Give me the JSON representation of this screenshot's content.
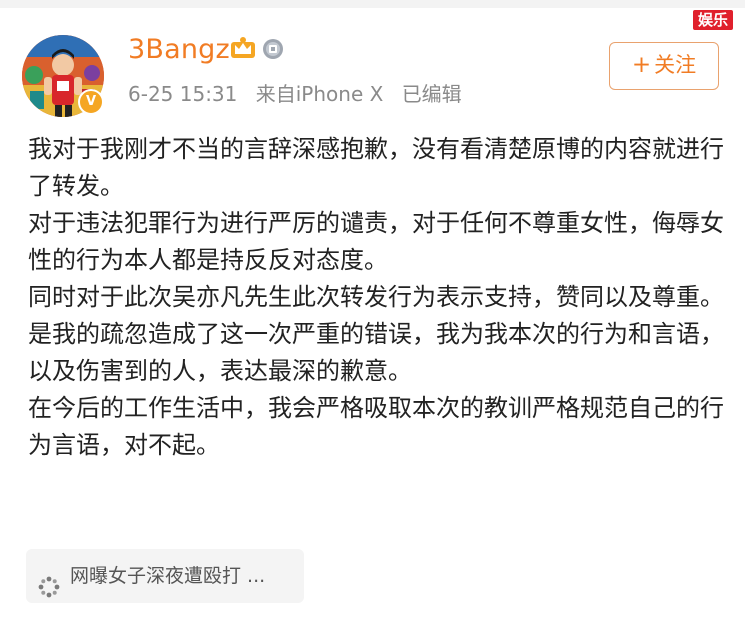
{
  "watermark": {
    "label": "娱乐"
  },
  "user": {
    "name": "3Bangz",
    "crown_icon": "crown-icon",
    "medal_icon": "medal-icon",
    "verified_icon": "verified-badge-icon"
  },
  "meta": {
    "time": "6-25 15:31",
    "source": "来自iPhone X",
    "edited": "已编辑"
  },
  "follow_button": {
    "plus": "+",
    "label": "关注"
  },
  "post": {
    "paragraphs": [
      "我对于我刚才不当的言辞深感抱歉，没有看清楚原博的内容就进行了转发。",
      "对于违法犯罪行为进行严厉的谴责，对于任何不尊重女性，侮辱女性的行为本人都是持反反对态度。",
      "同时对于此次吴亦凡先生此次转发行为表示支持，赞同以及尊重。",
      "是我的疏忽造成了这一次严重的错误，我为我本次的行为和言语，以及伤害到的人，表达最深的歉意。",
      "在今后的工作生活中，我会严格吸取本次的教训严格规范自己的行为言语，对不起。"
    ]
  },
  "link_card": {
    "icon": "link-icon",
    "text": "网曝女子深夜遭殴打 ..."
  },
  "colors": {
    "accent": "#f17c24",
    "watermark": "#e0202c",
    "meta_text": "#8a8a8a",
    "body_text": "#222222"
  }
}
